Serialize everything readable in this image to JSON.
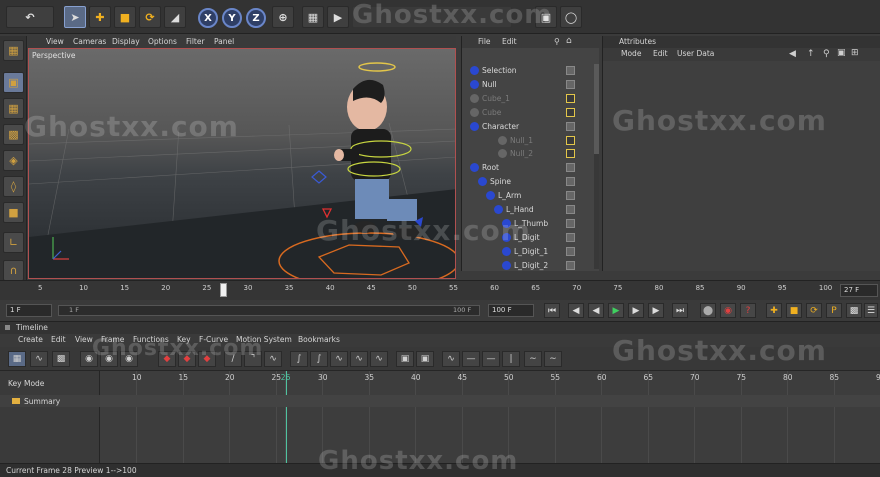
{
  "viewport": {
    "menu": [
      "View",
      "Cameras",
      "Display",
      "Options",
      "Filter",
      "Panel"
    ],
    "camera_label": "Perspective"
  },
  "objects": {
    "menu": [
      "File",
      "Edit"
    ],
    "rows": [
      {
        "name": "Selection",
        "dim": false
      },
      {
        "name": "Null",
        "dim": false
      },
      {
        "name": "Cube_1",
        "dim": true
      },
      {
        "name": "Cube",
        "dim": true
      },
      {
        "name": "Character",
        "dim": false
      },
      {
        "name": "Null_1",
        "dim": true
      },
      {
        "name": "Null_2",
        "dim": true
      },
      {
        "name": "Root",
        "dim": false
      },
      {
        "name": "Spine",
        "dim": false
      },
      {
        "name": "L_Arm",
        "dim": false
      },
      {
        "name": "L_Hand",
        "dim": false
      },
      {
        "name": "L_Thumb",
        "dim": false
      },
      {
        "name": "L_Digit",
        "dim": false
      },
      {
        "name": "L_Digit_1",
        "dim": false
      },
      {
        "name": "L_Digit_2",
        "dim": false
      }
    ]
  },
  "attributes": {
    "title": "Attributes",
    "menu": [
      "Mode",
      "Edit",
      "User Data"
    ]
  },
  "ruler": {
    "ticks": [
      "5",
      "10",
      "15",
      "20",
      "25",
      "30",
      "35",
      "40",
      "45",
      "50",
      "55",
      "60",
      "65",
      "70",
      "75",
      "80",
      "85",
      "90",
      "95",
      "100"
    ],
    "current_frame": "27 F",
    "playhead_frame": 27
  },
  "frame_controls": {
    "start": "1 F",
    "range_start": "1 F",
    "range_end": "100 F",
    "end": "100 F"
  },
  "timeline": {
    "title": "Timeline",
    "menu": [
      "Create",
      "Edit",
      "View",
      "Frame",
      "Functions",
      "Key",
      "F-Curve",
      "Motion System",
      "Bookmarks"
    ],
    "mode_label": "Key Mode",
    "summary_label": "Summary",
    "ticks": [
      "10",
      "15",
      "20",
      "25",
      "26",
      "30",
      "35",
      "40",
      "45",
      "50",
      "55",
      "60",
      "65",
      "70",
      "75",
      "80",
      "85",
      "9"
    ],
    "current_marker": "26"
  },
  "status": {
    "text": "Current Frame  28  Preview  1-->100"
  },
  "watermark": "Ghostxx.com",
  "colors": {
    "accent": "#e3c64a",
    "selection": "#5a6a86",
    "viewport_border": "#b05050",
    "playhead": "#4fc3a0"
  }
}
